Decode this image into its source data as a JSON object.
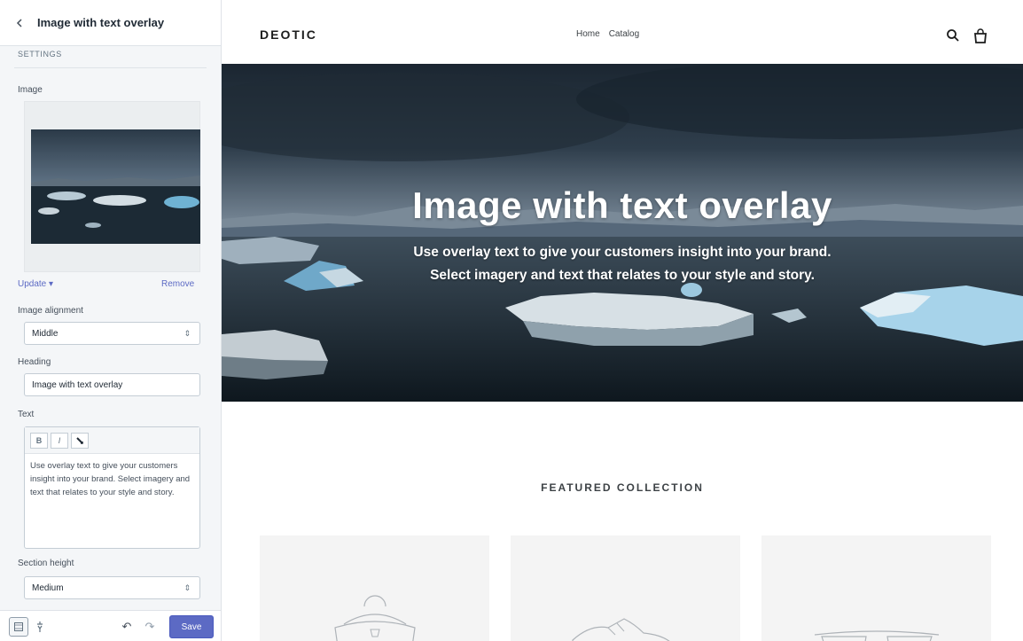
{
  "sidebar": {
    "title": "Image with text overlay",
    "section_label": "SETTINGS",
    "image_label": "Image",
    "update_label": "Update ▾",
    "remove_label": "Remove",
    "alignment": {
      "label": "Image alignment",
      "value": "Middle"
    },
    "heading": {
      "label": "Heading",
      "value": "Image with text overlay"
    },
    "text": {
      "label": "Text",
      "bold": "B",
      "italic": "I",
      "value": "Use overlay text to give your customers insight into your brand. Select imagery and text that relates to your style and story."
    },
    "section_height": {
      "label": "Section height",
      "value": "Medium"
    },
    "footer": {
      "save_label": "Save"
    }
  },
  "store": {
    "logo": "DEOTIC",
    "nav": [
      "Home",
      "Catalog"
    ],
    "hero": {
      "heading": "Image with text overlay",
      "sub_line1": "Use overlay text to give your customers insight into your brand.",
      "sub_line2": "Select imagery and text that relates to your style and story."
    },
    "featured_title": "FEATURED COLLECTION"
  },
  "icons": {
    "back": "chevron-left-icon",
    "search": "search-icon",
    "cart": "shopping-bag-icon",
    "link": "link-icon",
    "desktop": "desktop-view-icon",
    "mobile": "mobile-view-icon",
    "undo": "undo-icon",
    "redo": "redo-icon"
  },
  "colors": {
    "accent": "#5c6ac4",
    "sidebar_bg": "#f4f6f8",
    "hero_dark": "#1f2c37"
  }
}
